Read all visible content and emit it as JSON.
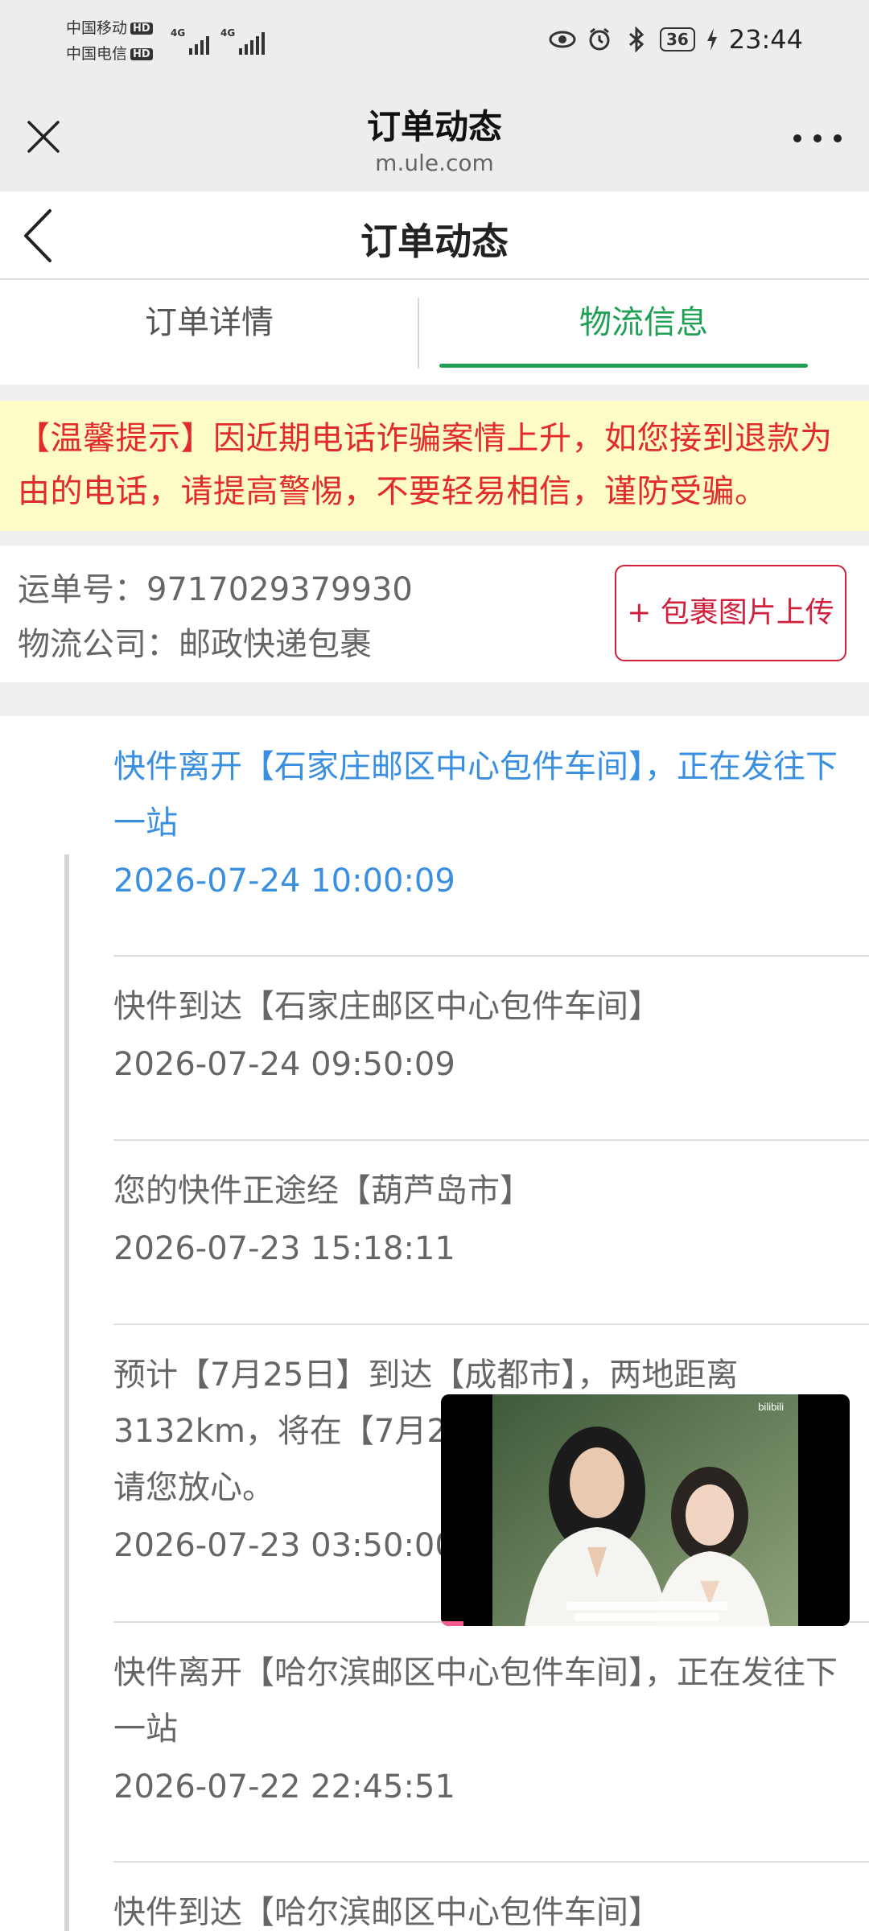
{
  "status_bar": {
    "carrier1": "中国移动",
    "carrier2": "中国电信",
    "hd": "HD",
    "network": "4G",
    "battery": "36",
    "time": "23:44"
  },
  "browser": {
    "title": "订单动态",
    "domain": "m.ule.com"
  },
  "page": {
    "title": "订单动态"
  },
  "tabs": [
    {
      "label": "订单详情",
      "active": false
    },
    {
      "label": "物流信息",
      "active": true
    }
  ],
  "notice": "【温馨提示】因近期电话诈骗案情上升，如您接到退款为由的电话，请提高警惕，不要轻易相信，谨防受骗。",
  "waybill": {
    "number_label": "运单号：",
    "number": "9717029379930",
    "company_label": "物流公司：",
    "company": "邮政快递包裹",
    "upload_button": "+ 包裹图片上传"
  },
  "timeline": [
    {
      "desc": "快件离开【石家庄邮区中心包件车间】，正在发往下一站",
      "time": "2026-07-24 10:00:09"
    },
    {
      "desc": "快件到达【石家庄邮区中心包件车间】",
      "time": "2026-07-24 09:50:09"
    },
    {
      "desc": "您的快件正途经【葫芦岛市】",
      "time": "2026-07-23 15:18:11"
    },
    {
      "desc": "预计【7月25日】到达【成都市】，两地距离3132km，将在【7月2",
      "desc_end": "请您放心。",
      "time": "2026-07-23 03:50:00"
    },
    {
      "desc": "快件离开【哈尔滨邮区中心包件车间】，正在发往下一站",
      "time": "2026-07-22 22:45:51"
    },
    {
      "desc": "快件到达【哈尔滨邮区中心包件车间】",
      "time": ""
    }
  ],
  "video": {
    "watermark": "bilibili"
  },
  "colors": {
    "accent_green": "#1fa055",
    "notice_red": "#e22b2b",
    "notice_bg": "#fdfbc6",
    "upload_red": "#d21f3c",
    "active_blue": "#3a8fe0"
  }
}
